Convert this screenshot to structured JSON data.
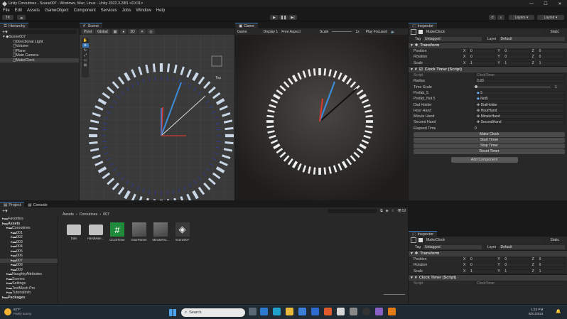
{
  "window": {
    "title": "Unity Coroutines - Scene007 - Windows, Mac, Linux - Unity 2022.3.28f1 <DX11>"
  },
  "menu": [
    "File",
    "Edit",
    "Assets",
    "GameObject",
    "Component",
    "Services",
    "Jobs",
    "Window",
    "Help"
  ],
  "toolbar": {
    "account": "TK",
    "layers": "Layers",
    "layout": "Layout"
  },
  "hierarchy": {
    "tab": "Hierarchy",
    "search_placeholder": "All",
    "items": [
      {
        "label": "Scene007",
        "level": 0,
        "icon": "unity-scene-icon"
      },
      {
        "label": "Directional Light",
        "level": 1
      },
      {
        "label": "Volume",
        "level": 1
      },
      {
        "label": "Plane",
        "level": 1
      },
      {
        "label": "Main Camera",
        "level": 1
      },
      {
        "label": "MakeClock",
        "level": 1,
        "selected": true
      }
    ]
  },
  "scene": {
    "tab": "Scene",
    "pivot": "Pivot",
    "global": "Global",
    "persp": "Top",
    "twod": "2D"
  },
  "game": {
    "tab": "Game",
    "mode": "Game",
    "display": "Display 1",
    "aspect": "Free Aspect",
    "scale_label": "Scale",
    "scale_value": "1x",
    "play_focus": "Play Focused"
  },
  "inspector": {
    "tab": "Inspector",
    "object_name": "MakeClock",
    "static": "Static",
    "tag_label": "Tag",
    "tag_value": "Untagged",
    "layer_label": "Layer",
    "layer_value": "Default",
    "transform": {
      "title": "Transform",
      "rows": [
        {
          "label": "Position",
          "x": "0",
          "y": "0",
          "z": "0"
        },
        {
          "label": "Rotation",
          "x": "0",
          "y": "0",
          "z": "0"
        },
        {
          "label": "Scale",
          "x": "1",
          "y": "1",
          "z": "1"
        }
      ]
    },
    "script": {
      "title": "Clock Timer (Script)",
      "script_label": "Script",
      "script_value": "ClockTimer",
      "radius_label": "Radius",
      "radius_value": "3.93",
      "timescale_label": "Time Scale",
      "timescale_value": "1",
      "timescale_fraction": 0.0,
      "prefab5_label": "Prefab_5",
      "prefab5_value": "5",
      "prefabnot5_label": "Prefab_Not 5",
      "prefabnot5_value": "Not5",
      "dial_label": "Dial Holder",
      "dial_value": "DialHolder",
      "hour_label": "Hour Hand",
      "hour_value": "HourHand",
      "minute_label": "Minute Hand",
      "minute_value": "MinuteHand",
      "second_label": "Second Hand",
      "second_value": "SecondHand",
      "elapsed_label": "Elapsed Time",
      "elapsed_value": "0",
      "buttons": [
        "Make Clock",
        "Start Timer",
        "Stop Timer",
        "Reset Timer"
      ]
    },
    "add_component": "Add Component"
  },
  "inspector2": {
    "tab": "Inspector",
    "object_name": "MakeClock",
    "static": "Static",
    "tag_label": "Tag",
    "tag_value": "Untagged",
    "layer_label": "Layer",
    "layer_value": "Default",
    "transform_title": "Transform",
    "script_title": "Clock Timer (Script)",
    "script_label": "Script",
    "script_value": "ClockTimer"
  },
  "project": {
    "tab": "Project",
    "console_tab": "Console",
    "breadcrumb": [
      "Assets",
      "Coroutines",
      "007"
    ],
    "count": "19",
    "tree": [
      {
        "label": "Favorites",
        "level": 0
      },
      {
        "label": "Assets",
        "level": 0,
        "bold": true
      },
      {
        "label": "Coroutines",
        "level": 1
      },
      {
        "label": "001",
        "level": 2
      },
      {
        "label": "002",
        "level": 2
      },
      {
        "label": "003",
        "level": 2
      },
      {
        "label": "004",
        "level": 2
      },
      {
        "label": "005",
        "level": 2
      },
      {
        "label": "006",
        "level": 2
      },
      {
        "label": "007",
        "level": 2,
        "selected": true
      },
      {
        "label": "008",
        "level": 2
      },
      {
        "label": "009",
        "level": 2
      },
      {
        "label": "NaughtyAttributes",
        "level": 1
      },
      {
        "label": "Scenes",
        "level": 1
      },
      {
        "label": "Settings",
        "level": 1
      },
      {
        "label": "TextMesh Pro",
        "level": 1
      },
      {
        "label": "TutorialInfo",
        "level": 1
      },
      {
        "label": "Packages",
        "level": 0,
        "bold": true
      }
    ],
    "assets": [
      {
        "label": "Dals",
        "icon": "folder-icon"
      },
      {
        "label": "HandMate...",
        "icon": "folder-icon"
      },
      {
        "label": "ClockTimer",
        "icon": "csharp-script-icon"
      },
      {
        "label": "HourParent",
        "icon": "prefab-icon"
      },
      {
        "label": "MinutePar...",
        "icon": "prefab-icon"
      },
      {
        "label": "Scene007",
        "icon": "unity-scene-icon"
      }
    ]
  },
  "taskbar": {
    "weather_temp": "82°F",
    "weather_desc": "Partly sunny",
    "search": "Search",
    "time": "1:22 PM",
    "date": "8/21/2024"
  },
  "colors": {
    "accent": "#3a79bb",
    "hour_hand": "#d43a2f",
    "minute_hand": "#3b8bd9",
    "second_hand": "#111111"
  }
}
